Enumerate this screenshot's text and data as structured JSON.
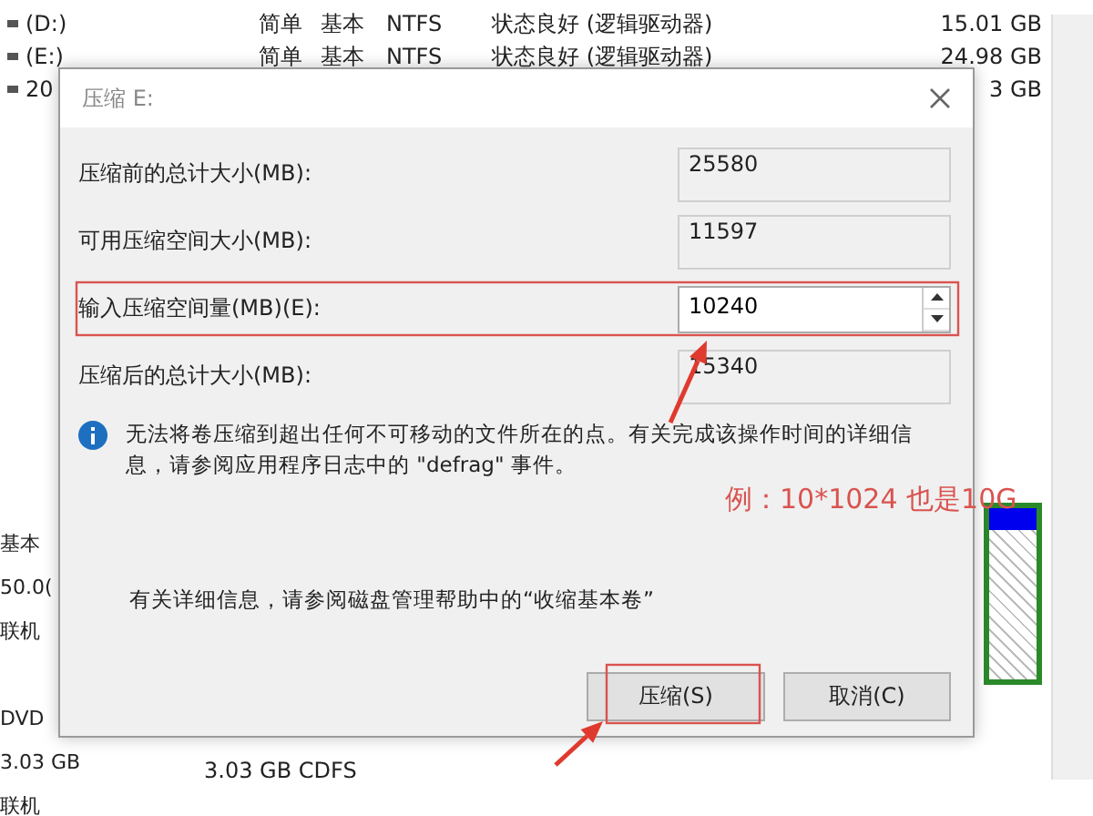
{
  "background": {
    "volumes": [
      {
        "name": "(D:)",
        "layout": "简单",
        "type": "基本",
        "fs": "NTFS",
        "status": "状态良好 (逻辑驱动器)",
        "capacity": "15.01 GB"
      },
      {
        "name": "(E:)",
        "layout": "简单",
        "type": "基本",
        "fs": "NTFS",
        "status": "状态良好 (逻辑驱动器)",
        "capacity": "24.98 GB"
      }
    ],
    "partial_row": {
      "name": "20",
      "capacity": "3 GB"
    },
    "disks": [
      {
        "lines": [
          "基本",
          "50.0(",
          "联机"
        ]
      },
      {
        "lines": [
          "DVD",
          "3.03 GB",
          "联机"
        ]
      }
    ],
    "cdrom_volume": "3.03 GB CDFS"
  },
  "dialog": {
    "title": "压缩 E:",
    "fields": [
      {
        "label": "压缩前的总计大小(MB):",
        "value": "25580",
        "kind": "readonly"
      },
      {
        "label": "可用压缩空间大小(MB):",
        "value": "11597",
        "kind": "readonly"
      },
      {
        "label": "输入压缩空间量(MB)(E):",
        "value": "10240",
        "kind": "spin"
      },
      {
        "label": "压缩后的总计大小(MB):",
        "value": "15340",
        "kind": "readonly"
      }
    ],
    "info": "无法将卷压缩到超出任何不可移动的文件所在的点。有关完成该操作时间的详细信息，请参阅应用程序日志中的 \"defrag\" 事件。",
    "help": "有关详细信息，请参阅磁盘管理帮助中的“收缩基本卷”",
    "buttons": [
      {
        "label": "压缩(S)",
        "highlighted": true
      },
      {
        "label": "取消(C)",
        "highlighted": false
      }
    ]
  },
  "annotation": {
    "text": "例：10*1024 也是10G"
  }
}
